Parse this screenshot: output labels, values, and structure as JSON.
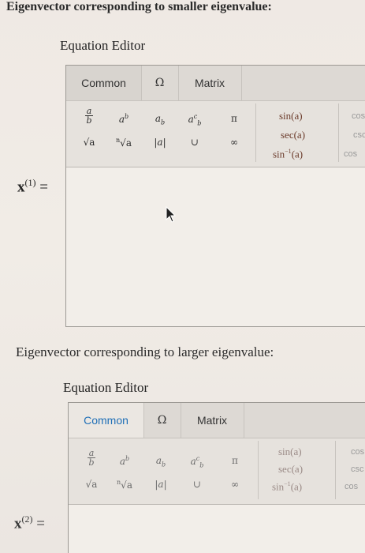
{
  "section1": {
    "title": "Eigenvector corresponding to smaller eigenvalue:",
    "editor_label": "Equation Editor",
    "vector_symbol": "x",
    "vector_index": "(1)",
    "equals": "="
  },
  "section2": {
    "title": "Eigenvector corresponding to larger eigenvalue:",
    "editor_label": "Equation Editor",
    "vector_symbol": "x",
    "vector_index": "(2)",
    "equals": "="
  },
  "tabs": {
    "common": "Common",
    "symbols": "Ω",
    "matrix": "Matrix"
  },
  "palette": {
    "frac_num": "a",
    "frac_den": "b",
    "power_base": "a",
    "power_exp": "b",
    "sub_base": "a",
    "sub_idx": "b",
    "subsup_base": "a",
    "subsup_sup": "c",
    "subsup_sub": "b",
    "pi": "π",
    "sqrt": "√a",
    "nthroot_idx": "n",
    "nthroot": "√a",
    "abs": "|a|",
    "union": "∪",
    "infinity": "∞"
  },
  "trig": {
    "sin": "sin(a)",
    "sec": "sec(a)",
    "arcsin_fn": "sin",
    "arcsin_exp": "−1",
    "arcsin_arg": "(a)",
    "col2_1": "cos",
    "col2_2": "csc",
    "col2_3": "cos"
  },
  "colors": {
    "active_tab_section2": "#1f6fb7",
    "trig_text": "#6b3b2b"
  }
}
